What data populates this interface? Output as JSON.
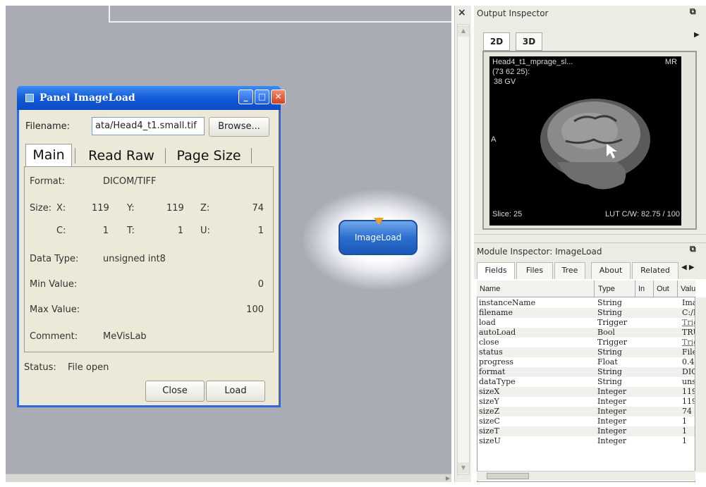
{
  "canvas": {
    "close_glyph": "×"
  },
  "dialog": {
    "title": "Panel ImageLoad",
    "filename_label": "Filename:",
    "filename_value": "ata/Head4_t1.small.tif",
    "browse_label": "Browse...",
    "tabs": [
      "Main",
      "Read Raw",
      "Page Size"
    ],
    "format_label": "Format:",
    "format_value": "DICOM/TIFF",
    "size_label": "Size:",
    "x_label": "X:",
    "x_value": "119",
    "y_label": "Y:",
    "y_value": "119",
    "z_label": "Z:",
    "z_value": "74",
    "c_label": "C:",
    "c_value": "1",
    "t_label": "T:",
    "t_value": "1",
    "u_label": "U:",
    "u_value": "1",
    "datatype_label": "Data Type:",
    "datatype_value": "unsigned int8",
    "min_label": "Min Value:",
    "min_value": "0",
    "max_label": "Max Value:",
    "max_value": "100",
    "comment_label": "Comment:",
    "comment_value": "MeVisLab",
    "status_label": "Status:",
    "status_value": "File open",
    "close_label": "Close",
    "load_label": "Load"
  },
  "module": {
    "label": "ImageLoad"
  },
  "output_inspector": {
    "title": "Output Inspector",
    "tabs": [
      "2D",
      "3D"
    ],
    "viewer": {
      "line1": "Head4_t1_mprage_sl...",
      "modality": "MR",
      "coords": "(73 62 25):",
      "value": "38 GV",
      "orient": "A",
      "slice": "Slice: 25",
      "lut": "LUT C/W: 82.75 / 100"
    }
  },
  "module_inspector": {
    "title": "Module Inspector: ImageLoad",
    "tabs": [
      "Fields",
      "Files",
      "Tree",
      "About",
      "Related"
    ],
    "columns": [
      "Name",
      "Type",
      "In",
      "Out",
      "Valu"
    ],
    "rows": [
      {
        "name": "instanceName",
        "type": "String",
        "value": "Ima"
      },
      {
        "name": "filename",
        "type": "String",
        "value": "C:/I"
      },
      {
        "name": "load",
        "type": "Trigger",
        "value": "Trig"
      },
      {
        "name": "autoLoad",
        "type": "Bool",
        "value": "TRU"
      },
      {
        "name": "close",
        "type": "Trigger",
        "value": "Trig"
      },
      {
        "name": "status",
        "type": "String",
        "value": "File"
      },
      {
        "name": "progress",
        "type": "Float",
        "value": "0.4"
      },
      {
        "name": "format",
        "type": "String",
        "value": "DIC"
      },
      {
        "name": "dataType",
        "type": "String",
        "value": "uns"
      },
      {
        "name": "sizeX",
        "type": "Integer",
        "value": "119"
      },
      {
        "name": "sizeY",
        "type": "Integer",
        "value": "119"
      },
      {
        "name": "sizeZ",
        "type": "Integer",
        "value": "74"
      },
      {
        "name": "sizeC",
        "type": "Integer",
        "value": "1"
      },
      {
        "name": "sizeT",
        "type": "Integer",
        "value": "1"
      },
      {
        "name": "sizeU",
        "type": "Integer",
        "value": "1"
      }
    ]
  },
  "colors": {
    "titlebar": "#1459d9",
    "module": "#2a6fcf",
    "canvas": "#a9acb4"
  }
}
